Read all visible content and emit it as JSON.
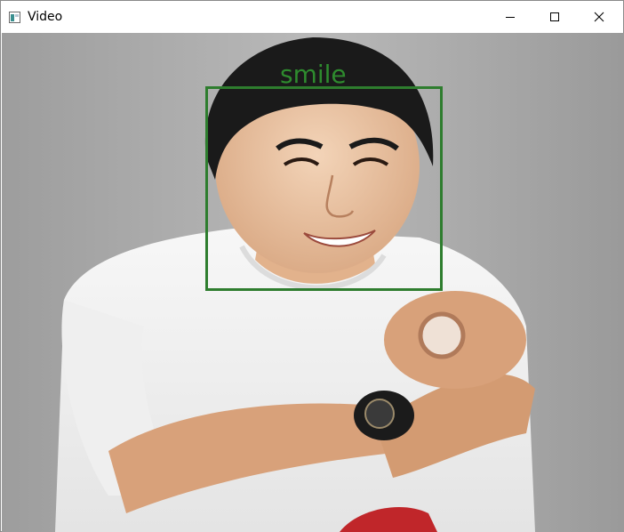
{
  "window": {
    "title": "Video",
    "app_icon": "opencv-window-icon",
    "controls": {
      "minimize_icon": "minimize-icon",
      "maximize_icon": "maximize-icon",
      "close_icon": "close-icon"
    }
  },
  "video": {
    "detection": {
      "label": "smile",
      "box_color": "#2e7d2e"
    }
  }
}
